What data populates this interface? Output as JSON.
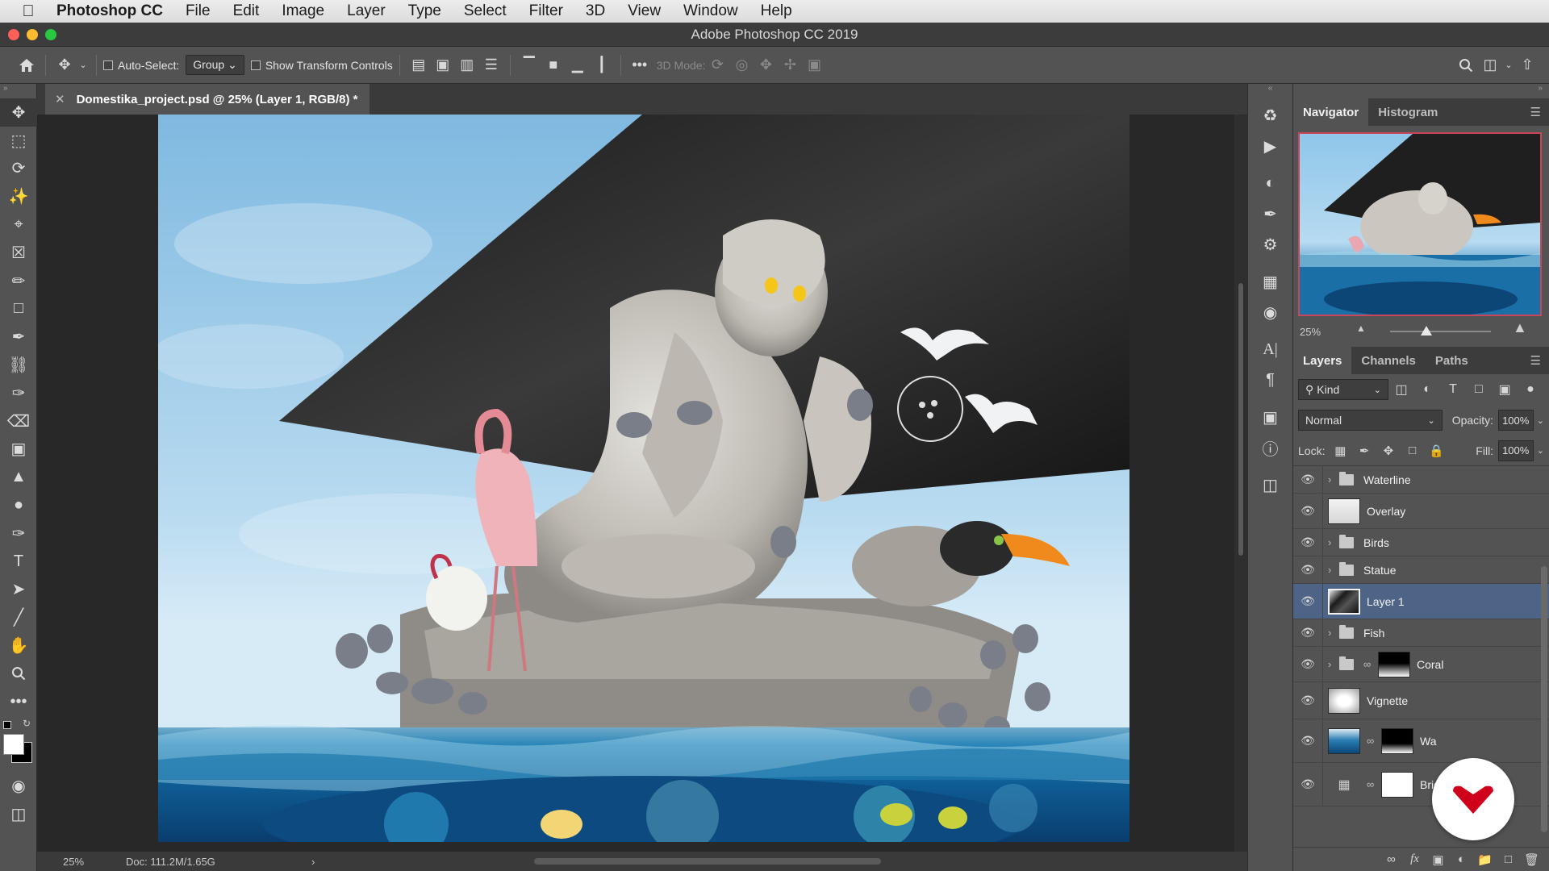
{
  "menubar": {
    "app_name": "Photoshop CC",
    "items": [
      "File",
      "Edit",
      "Image",
      "Layer",
      "Type",
      "Select",
      "Filter",
      "3D",
      "View",
      "Window",
      "Help"
    ]
  },
  "window": {
    "title": "Adobe Photoshop CC 2019"
  },
  "options_bar": {
    "auto_select_label": "Auto-Select:",
    "auto_select_value": "Group",
    "show_transform_label": "Show Transform Controls",
    "three_d_mode_label": "3D Mode:"
  },
  "document": {
    "tab_title": "Domestika_project.psd @ 25% (Layer 1, RGB/8) *"
  },
  "status_bar": {
    "zoom": "25%",
    "doc_info": "Doc: 111.2M/1.65G"
  },
  "navigator": {
    "tabs": [
      "Navigator",
      "Histogram"
    ],
    "zoom": "25%"
  },
  "layers_panel": {
    "tabs": [
      "Layers",
      "Channels",
      "Paths"
    ],
    "filter_label": "Kind",
    "blend_mode": "Normal",
    "opacity_label": "Opacity:",
    "opacity_value": "100%",
    "lock_label": "Lock:",
    "fill_label": "Fill:",
    "fill_value": "100%",
    "layers": [
      {
        "name": "Waterline",
        "type": "group"
      },
      {
        "name": "Overlay",
        "type": "pixel"
      },
      {
        "name": "Birds",
        "type": "group"
      },
      {
        "name": "Statue",
        "type": "group"
      },
      {
        "name": "Layer 1",
        "type": "pixel",
        "selected": true
      },
      {
        "name": "Fish",
        "type": "group"
      },
      {
        "name": "Coral",
        "type": "group-mask"
      },
      {
        "name": "Vignette",
        "type": "pixel"
      },
      {
        "name": "Wa",
        "type": "pixel-mask"
      },
      {
        "name": "Brig",
        "type": "adjustment-mask"
      }
    ]
  },
  "colors": {
    "accent_selected": "#4d6486",
    "brand_red": "#d0021b",
    "traffic_close": "#fe5f57",
    "traffic_min": "#febc2e",
    "traffic_max": "#28c840"
  }
}
